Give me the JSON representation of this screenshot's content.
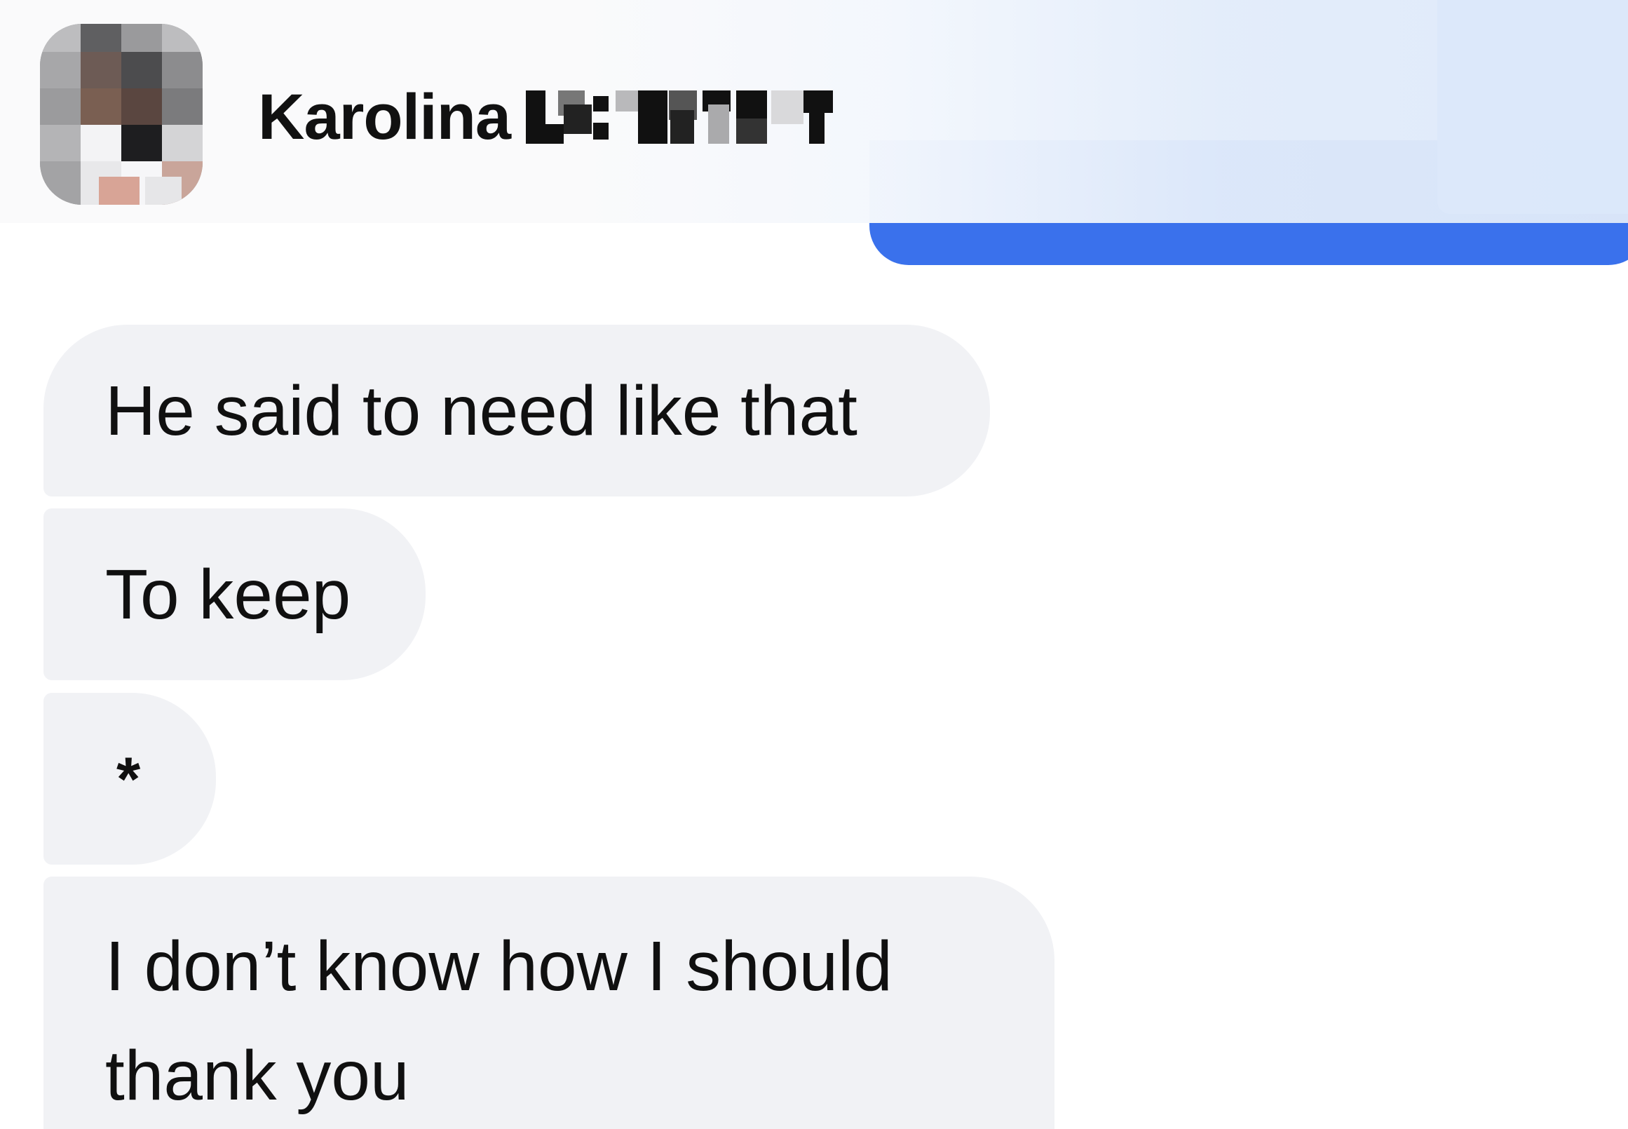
{
  "header": {
    "contact_first_name": "Karolina",
    "contact_surname_redacted": true,
    "avatar": "pixelated-profile-photo"
  },
  "messages": [
    {
      "direction": "incoming",
      "text": "He said to need like that"
    },
    {
      "direction": "incoming",
      "text": "To keep"
    },
    {
      "direction": "incoming",
      "text": "*"
    },
    {
      "direction": "incoming",
      "text": "I don’t know how I should thank you"
    }
  ],
  "colors": {
    "incoming_bubble": "#f1f2f5",
    "outgoing_bubble": "#3a71ec",
    "text": "#101010",
    "header_tint": "#dee9f9"
  }
}
